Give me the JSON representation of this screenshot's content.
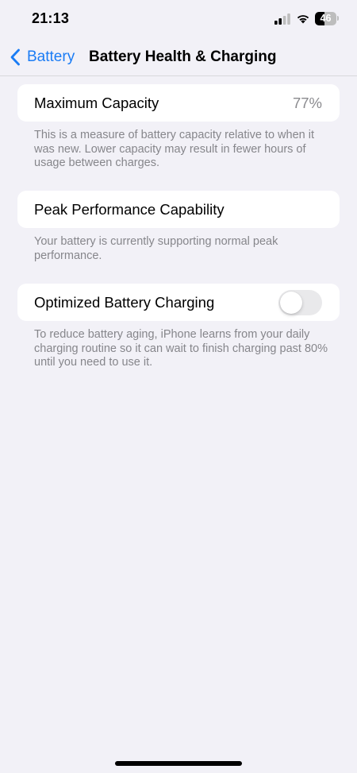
{
  "status_bar": {
    "time": "21:13",
    "battery_level": "46",
    "battery_fraction": 0.46,
    "icons": [
      "signal-icon",
      "wifi-icon",
      "battery-icon"
    ]
  },
  "nav": {
    "back_label": "Battery",
    "title": "Battery Health & Charging",
    "accent_color": "#1a7cf5"
  },
  "sections": {
    "max_capacity": {
      "label": "Maximum Capacity",
      "value": "77%",
      "footnote": "This is a measure of battery capacity relative to when it was new. Lower capacity may result in fewer hours of usage between charges."
    },
    "peak_performance": {
      "label": "Peak Performance Capability",
      "footnote": "Your battery is currently supporting normal peak performance."
    },
    "optimized_charging": {
      "label": "Optimized Battery Charging",
      "enabled": false,
      "footnote": "To reduce battery aging, iPhone learns from your daily charging routine so it can wait to finish charging past 80% until you need to use it."
    }
  }
}
